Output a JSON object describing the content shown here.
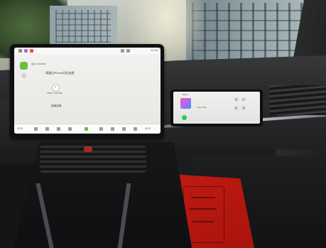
{
  "main_screen": {
    "app_title": "App Connect",
    "content_title": "请通过iPhone扫码连接",
    "round_button_caption": "Open CarPlay",
    "link_text": "使用说明",
    "status_time": "12:18",
    "dock_temp_left": "22.5",
    "dock_temp_right": "22.5",
    "accent_color": "#6bbf3b"
  },
  "passenger_screen": {
    "title": "Music",
    "song_title": "Song Title",
    "play_color": "#2dc94f"
  }
}
